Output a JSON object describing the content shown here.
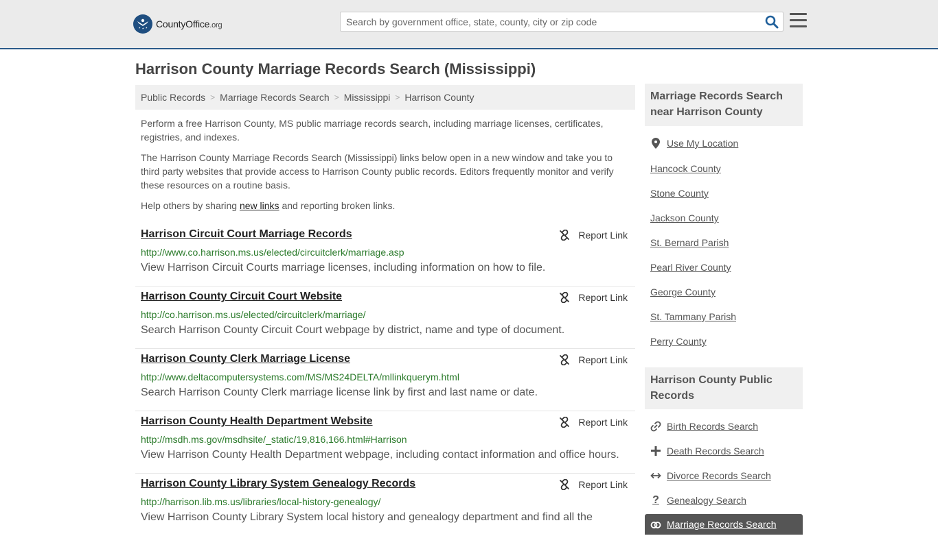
{
  "header": {
    "logo_name": "CountyOffice",
    "logo_tld": ".org",
    "search_placeholder": "Search by government office, state, county, city or zip code"
  },
  "page_title": "Harrison County Marriage Records Search (Mississippi)",
  "breadcrumb": [
    "Public Records",
    "Marriage Records Search",
    "Mississippi",
    "Harrison County"
  ],
  "intro": {
    "p1": "Perform a free Harrison County, MS public marriage records search, including marriage licenses, certificates, registries, and indexes.",
    "p2": "The Harrison County Marriage Records Search (Mississippi) links below open in a new window and take you to third party websites that provide access to Harrison County public records. Editors frequently monitor and verify these resources on a routine basis.",
    "p3_before": "Help others by sharing ",
    "p3_link": "new links",
    "p3_after": " and reporting broken links."
  },
  "report_label": "Report Link",
  "results": [
    {
      "title": "Harrison Circuit Court Marriage Records",
      "url": "http://www.co.harrison.ms.us/elected/circuitclerk/marriage.asp",
      "desc": "View Harrison Circuit Courts marriage licenses, including information on how to file."
    },
    {
      "title": "Harrison County Circuit Court Website",
      "url": "http://co.harrison.ms.us/elected/circuitclerk/marriage/",
      "desc": "Search Harrison County Circuit Court webpage by district, name and type of document."
    },
    {
      "title": "Harrison County Clerk Marriage License",
      "url": "http://www.deltacomputersystems.com/MS/MS24DELTA/mllinkquerym.html",
      "desc": "Search Harrison County Clerk marriage license link by first and last name or date."
    },
    {
      "title": "Harrison County Health Department Website",
      "url": "http://msdh.ms.gov/msdhsite/_static/19,816,166.html#Harrison",
      "desc": "View Harrison County Health Department webpage, including contact information and office hours."
    },
    {
      "title": "Harrison County Library System Genealogy Records",
      "url": "http://harrison.lib.ms.us/libraries/local-history-genealogy/",
      "desc": "View Harrison County Library System local history and genealogy department and find all the"
    }
  ],
  "sidebar": {
    "nearby_heading": "Marriage Records Search near Harrison County",
    "use_location": "Use My Location",
    "nearby": [
      "Hancock County",
      "Stone County",
      "Jackson County",
      "St. Bernard Parish",
      "Pearl River County",
      "George County",
      "St. Tammany Parish",
      "Perry County"
    ],
    "public_heading": "Harrison County Public Records",
    "public_links": [
      {
        "label": "Birth Records Search",
        "icon": "link-icon"
      },
      {
        "label": "Death Records Search",
        "icon": "plus-icon"
      },
      {
        "label": "Divorce Records Search",
        "icon": "arrows-icon"
      },
      {
        "label": "Genealogy Search",
        "icon": "question-icon"
      }
    ],
    "active_link": "Marriage Records Search"
  }
}
